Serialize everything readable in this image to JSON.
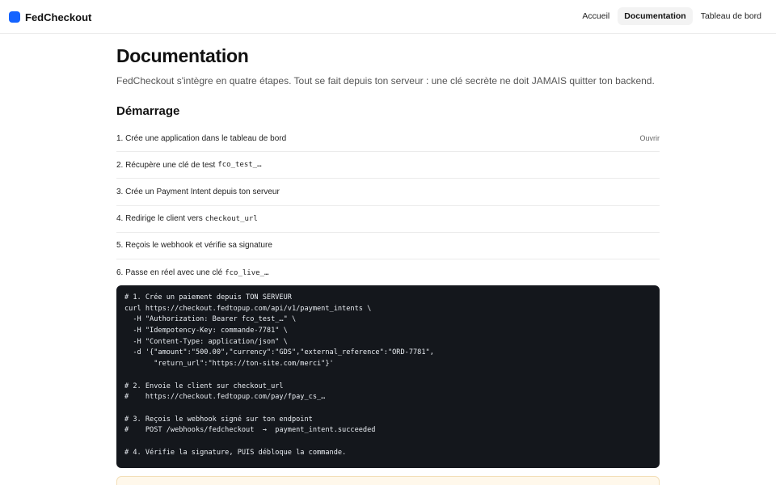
{
  "app": {
    "name": "FedCheckout",
    "logo_color": "#1463ff"
  },
  "nav": {
    "items": [
      {
        "label": "Accueil",
        "active": false
      },
      {
        "label": "Documentation",
        "active": true
      },
      {
        "label": "Tableau de bord",
        "active": false
      }
    ]
  },
  "page": {
    "title": "Documentation",
    "lead": "FedCheckout s'intègre en quatre étapes. Tout se fait depuis ton serveur : une clé secrète ne doit JAMAIS quitter ton backend."
  },
  "section": {
    "title": "Démarrage"
  },
  "steps": [
    {
      "text": "1. Crée une application dans le tableau de bord",
      "code": "",
      "action": "Ouvrir"
    },
    {
      "text": "2. Récupère une clé de test",
      "code": "fco_test_…",
      "action": ""
    },
    {
      "text": "3. Crée un Payment Intent depuis ton serveur",
      "code": "",
      "action": ""
    },
    {
      "text": "4. Redirige le client vers",
      "code": "checkout_url",
      "action": ""
    },
    {
      "text": "5. Reçois le webhook et vérifie sa signature",
      "code": "",
      "action": ""
    },
    {
      "text": "6. Passe en réel avec une clé",
      "code": "fco_live_…",
      "action": ""
    }
  ],
  "code_block": {
    "lines": [
      "# 1. Crée un paiement depuis TON SERVEUR",
      "curl https://checkout.fedtopup.com/api/v1/payment_intents \\",
      "  -H \"Authorization: Bearer fco_test_…\" \\",
      "  -H \"Idempotency-Key: commande-7781\" \\",
      "  -H \"Content-Type: application/json\" \\",
      "  -d '{\"amount\":\"500.00\",\"currency\":\"GDS\",\"external_reference\":\"ORD-7781\",",
      "       \"return_url\":\"https://ton-site.com/merci\"}'",
      "",
      "# 2. Envoie le client sur checkout_url",
      "#    https://checkout.fedtopup.com/pay/fpay_cs_…",
      "",
      "# 3. Reçois le webhook signé sur ton endpoint",
      "#    POST /webhooks/fedcheckout  →  payment_intent.succeeded",
      "",
      "# 4. Vérifie la signature, PUIS débloque la commande."
    ]
  },
  "callout": {
    "color": "#fff8eb"
  }
}
